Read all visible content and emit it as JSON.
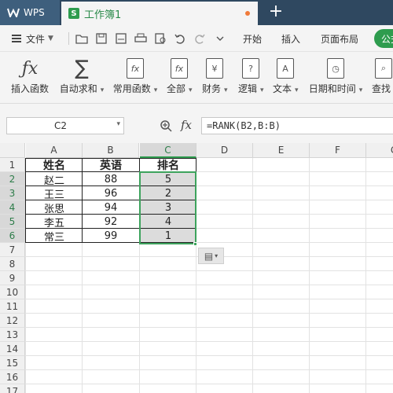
{
  "titlebar": {
    "app_label": "WPS",
    "doc_tab": "工作簿1",
    "new_tab_glyph": "+"
  },
  "menubar": {
    "file_label": "文件",
    "tabs": [
      "开始",
      "插入",
      "页面布局",
      "公式"
    ]
  },
  "ribbon": {
    "buttons": [
      {
        "label": "插入函数",
        "icon": "fx-icon"
      },
      {
        "label": "自动求和",
        "icon": "sigma-icon"
      },
      {
        "label": "常用函数",
        "icon": "common-function-icon"
      },
      {
        "label": "全部",
        "icon": "all-functions-icon"
      },
      {
        "label": "财务",
        "icon": "finance-icon"
      },
      {
        "label": "逻辑",
        "icon": "logic-icon"
      },
      {
        "label": "文本",
        "icon": "text-icon"
      },
      {
        "label": "日期和时间",
        "icon": "clock-icon"
      },
      {
        "label": "查找",
        "icon": "lookup-icon"
      }
    ]
  },
  "formula_bar": {
    "name_box": "C2",
    "fx": "fx",
    "formula": "=RANK(B2,B:B)"
  },
  "sheet": {
    "columns": [
      "A",
      "B",
      "C",
      "D",
      "E",
      "F",
      "G"
    ],
    "rows": [
      "1",
      "2",
      "3",
      "4",
      "5",
      "6",
      "7",
      "8",
      "9",
      "10",
      "11",
      "12",
      "13",
      "14",
      "15",
      "16",
      "17"
    ],
    "active_column": "C",
    "headers": [
      "姓名",
      "英语",
      "排名"
    ],
    "data": [
      [
        "赵二",
        "88",
        "5"
      ],
      [
        "王三",
        "96",
        "2"
      ],
      [
        "张思",
        "94",
        "3"
      ],
      [
        "李五",
        "92",
        "4"
      ],
      [
        "常三",
        "99",
        "1"
      ]
    ]
  },
  "colors": {
    "accent": "#2e9c4e",
    "titlebar": "#2f4860",
    "selection_border": "#3da35d"
  }
}
